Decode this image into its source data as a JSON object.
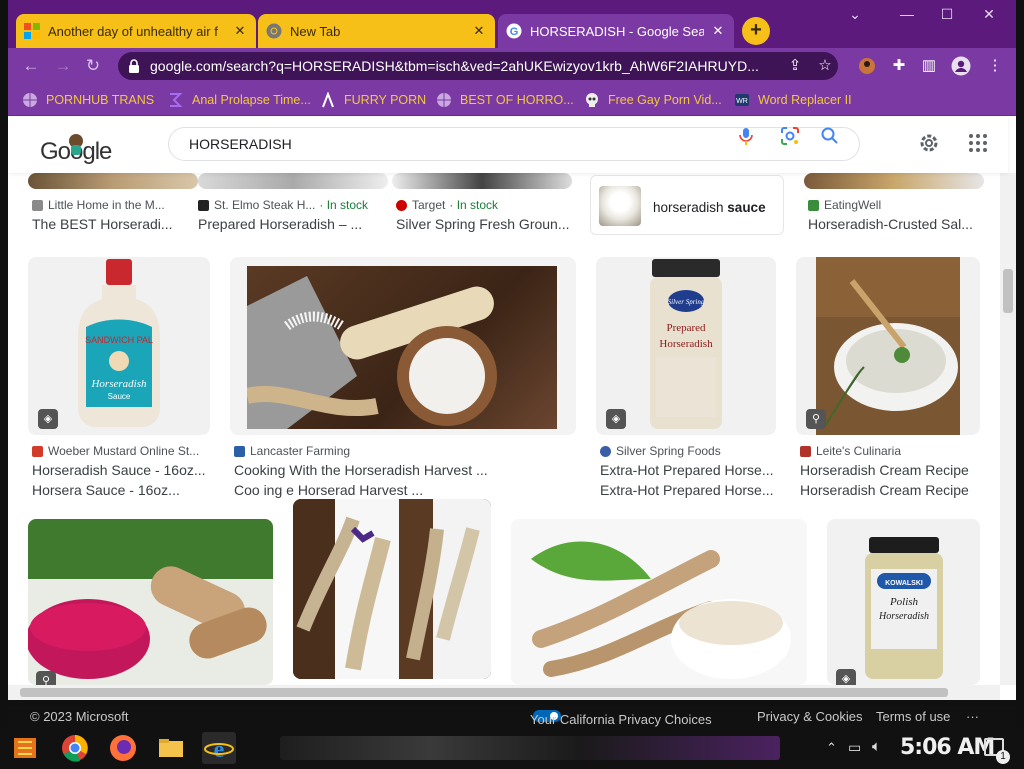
{
  "tabs": [
    {
      "label": "Another day of unhealthy air f",
      "close": "✕",
      "icon": "microsoft-icon"
    },
    {
      "label": "New Tab",
      "close": "✕",
      "icon": "chrome-icon"
    },
    {
      "label": "HORSERADISH - Google Sear",
      "close": "✕",
      "icon": "google-icon"
    }
  ],
  "new_tab_label": "+",
  "window_controls": {
    "minimize": "—",
    "maximize": "☐",
    "close": "✕",
    "chevron": "⌄"
  },
  "address": {
    "url": "google.com/search?q=HORSERADISH&tbm=isch&ved=2ahUKEwizyov1krb_AhW6F2IAHRUYD..."
  },
  "bookmarks": [
    {
      "label": "PORNHUB TRANS"
    },
    {
      "label": "Anal Prolapse Time..."
    },
    {
      "label": "FURRY PORN"
    },
    {
      "label": "BEST OF HORRO..."
    },
    {
      "label": "Free Gay Porn Vid..."
    },
    {
      "label": "Word Replacer II"
    }
  ],
  "google": {
    "logo": "Google",
    "query": "HORSERADISH"
  },
  "top_row": [
    {
      "source": "Little Home in the M...",
      "title": "The BEST Horseradi..."
    },
    {
      "source": "St. Elmo Steak H...",
      "stock": "· In stock",
      "title": "Prepared Horseradish – ..."
    },
    {
      "source": "Target",
      "stock": "· In stock",
      "title": "Silver Spring Fresh Groun..."
    },
    {
      "source": "EatingWell",
      "title": "Horseradish-Crusted Sal..."
    }
  ],
  "related_chip": {
    "prefix": "horseradish ",
    "bold": "sauce"
  },
  "row2": [
    {
      "source": "Woeber Mustard Online St...",
      "title": "Horseradish Sauce - 16oz...",
      "title2": "Horsera        Sauce - 16oz..."
    },
    {
      "source": "Lancaster Farming",
      "title": "Cooking With the Horseradish Harvest ...",
      "title2": "Coo    ing                e Horserad        Harvest ..."
    },
    {
      "source": "Silver Spring Foods",
      "title": "Extra-Hot Prepared Horse...",
      "title2": "Extra-Hot Prepared Horse..."
    },
    {
      "source": "Leite's Culinaria",
      "title": "Horseradish Cream Recipe",
      "title2": "Horseradish Cream Recipe"
    }
  ],
  "product_labels": {
    "woeber_brand": "SANDWICH PAL",
    "woeber_name": "Horseradish",
    "woeber_sub": "Sauce",
    "silver_brand": "Silver Spring",
    "silver_name1": "Prepared",
    "silver_name2": "Horseradish",
    "kowalski_brand": "KOWALSKI",
    "kowalski_name1": "Polish",
    "kowalski_name2": "Horseradish"
  },
  "footer": {
    "copyright": "© 2023 Microsoft",
    "privacy_choices": "Your California Privacy Choices",
    "privacy_cookies": "Privacy & Cookies",
    "terms": "Terms of use",
    "more": "···"
  },
  "clock": "5:06 AM",
  "notifications_count": "1",
  "colors": {
    "chrome_frame": "#5b1a7c",
    "toolbar": "#7b3aa3",
    "tab_inactive": "#f6c019",
    "bookmark_text": "#f2c93a",
    "in_stock": "#188038"
  }
}
